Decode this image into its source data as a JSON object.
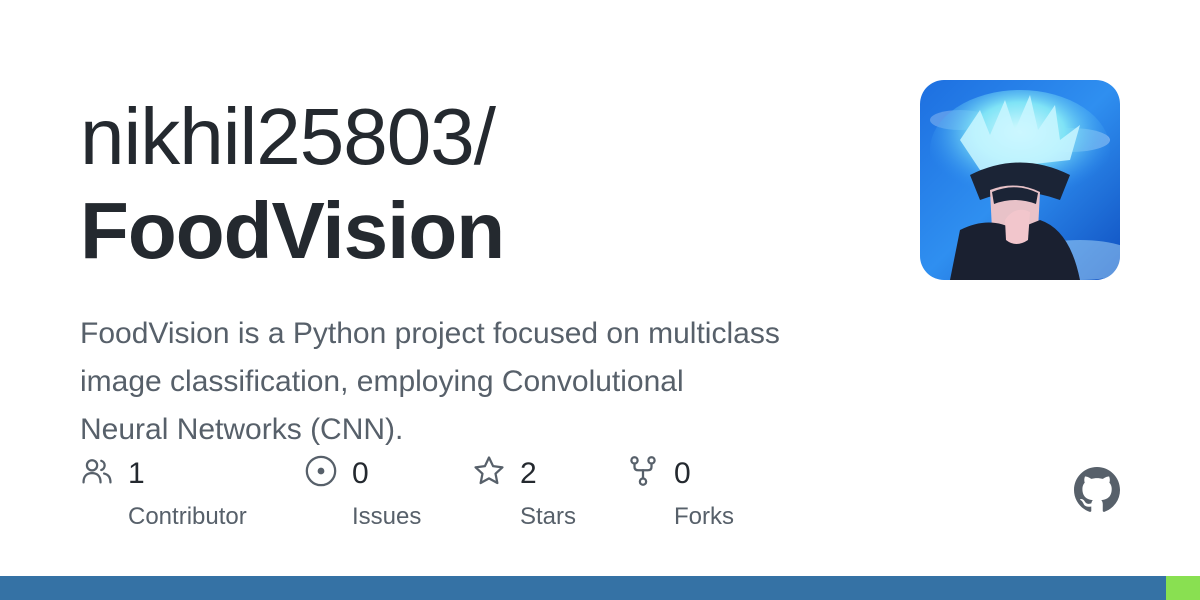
{
  "repo": {
    "owner_slash": "nikhil25803/",
    "name": "FoodVision",
    "description": "FoodVision is a Python project focused on multiclass image classification, employing Convolutional Neural Networks (CNN)."
  },
  "stats": {
    "contributors": {
      "count": "1",
      "label": "Contributor",
      "icon": "people-icon"
    },
    "issues": {
      "count": "0",
      "label": "Issues",
      "icon": "issue-opened-icon"
    },
    "stars": {
      "count": "2",
      "label": "Stars",
      "icon": "star-icon"
    },
    "forks": {
      "count": "0",
      "label": "Forks",
      "icon": "repo-forked-icon"
    }
  },
  "avatar": {
    "icon": "avatar-image"
  },
  "logo": {
    "icon": "github-mark-icon"
  },
  "language_bar": [
    {
      "color": "#3572A5",
      "fraction": 0.972
    },
    {
      "color": "#89e051",
      "fraction": 0.028
    }
  ],
  "colors": {
    "text_primary": "#24292f",
    "text_secondary": "#57606a",
    "icon": "#57606a"
  }
}
